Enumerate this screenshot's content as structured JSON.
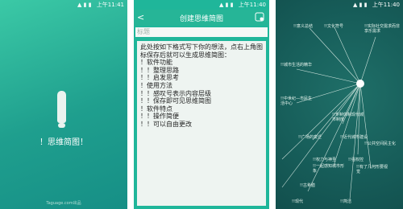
{
  "status": {
    "time": "上午11:41",
    "time2": "上午11:40",
    "time3": "上午11:40"
  },
  "splash": {
    "title": "！思维简图！",
    "watermark": "Taguage.com出品"
  },
  "editor": {
    "header_title": "创建思维简图",
    "title_placeholder": "标题",
    "content": "此处按如下格式写下你的想法，点右上角图标保存后就可以生成思维简图：\n！软件功能\n！！整理思路\n！！启发思考\n！使用方法\n！！感叹号表示内容层级\n！！保存即可见思维简图\n！软件特点\n！！操作简便\n！！可以自由更改"
  },
  "mindmap": {
    "labels": [
      {
        "text": "!!意义总结",
        "cls": "a"
      },
      {
        "text": "!!文化符号",
        "cls": "b"
      },
      {
        "text": "!!实际社交需求而非享乐需求",
        "cls": "c"
      },
      {
        "text": "!!城市生活的精华",
        "cls": "d"
      },
      {
        "text": "!!中世纪—市民生活中心",
        "cls": "e"
      },
      {
        "text": "!!专制体制现代城市制度",
        "cls": "f"
      },
      {
        "text": "!!广场的变迁",
        "cls": "g"
      },
      {
        "text": "!!近代城市建设",
        "cls": "h"
      },
      {
        "text": "!!公共空间民主化",
        "cls": "i"
      },
      {
        "text": "!!权力与神圣",
        "cls": "j"
      },
      {
        "text": "!!一起感知城市形象",
        "cls": "k"
      },
      {
        "text": "!!古希腊",
        "cls": "l"
      },
      {
        "text": "!!强权控",
        "cls": "m"
      },
      {
        "text": "!!有了几何形要视觉",
        "cls": "n"
      },
      {
        "text": "!!现代",
        "cls": "o"
      },
      {
        "text": "!!简洁",
        "cls": "p"
      }
    ]
  }
}
